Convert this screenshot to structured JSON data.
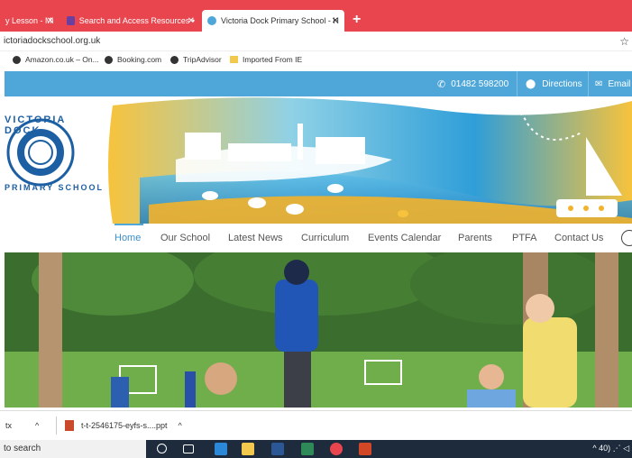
{
  "browser": {
    "tabs": [
      {
        "label": "y Lesson - Mi",
        "active": false,
        "favicon_color": "#e04a52"
      },
      {
        "label": "Search and Access Resources •",
        "active": false,
        "favicon_color": "#6b3fa0"
      },
      {
        "label": "Victoria Dock Primary School - H",
        "active": true,
        "favicon_color": "#4ea7d8"
      }
    ],
    "new_tab_label": "+",
    "close_glyph": "✕",
    "address": "ictoriadockschool.org.uk",
    "star_glyph": "☆",
    "bookmarks": [
      {
        "label": "Amazon.co.uk – On...",
        "icon": "globe-icon"
      },
      {
        "label": "Booking.com",
        "icon": "globe-icon"
      },
      {
        "label": "TripAdvisor",
        "icon": "globe-icon"
      },
      {
        "label": "Imported From IE",
        "icon": "folder-icon"
      }
    ]
  },
  "site": {
    "topbar": {
      "phone": "01482 598200",
      "directions": "Directions",
      "email": "Email",
      "color": "#4ea7d8"
    },
    "logo": {
      "top_text": "VICTORIA DOCK",
      "bottom_text": "PRIMARY SCHOOL",
      "color": "#1d5fa3"
    },
    "nav": {
      "items": [
        "Home",
        "Our School",
        "Latest News",
        "Curriculum",
        "Events Calendar",
        "Parents",
        "PTFA",
        "Contact Us"
      ],
      "active": "Home"
    }
  },
  "downloads": {
    "items": [
      {
        "label": "tx",
        "chevron": "^"
      },
      {
        "label": "t-t-2546175-eyfs-s....ppt",
        "chevron": "^"
      }
    ]
  },
  "taskbar": {
    "search_placeholder": "to search",
    "tray_text": "^ 40) ⋰ ◁"
  }
}
